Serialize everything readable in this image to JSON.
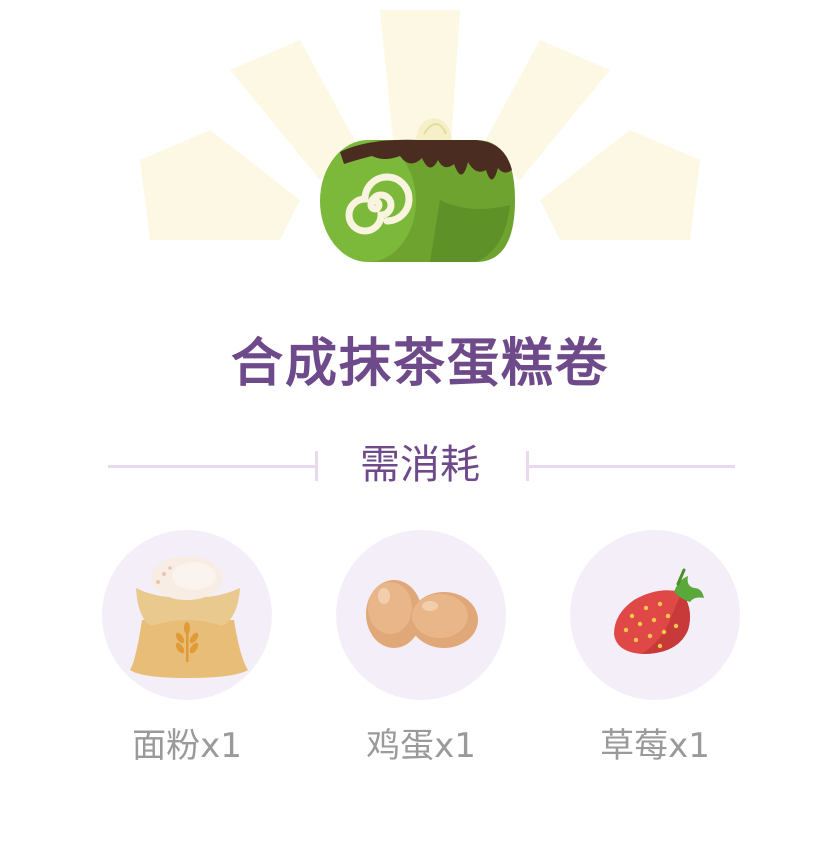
{
  "recipe": {
    "title": "合成抹茶蛋糕卷",
    "image_icon": "matcha-cake-roll-icon"
  },
  "consume": {
    "label": "需消耗"
  },
  "ingredients": [
    {
      "icon": "flour-sack-icon",
      "label": "面粉x1"
    },
    {
      "icon": "eggs-icon",
      "label": "鸡蛋x1"
    },
    {
      "icon": "strawberry-icon",
      "label": "草莓x1"
    }
  ],
  "colors": {
    "title": "#6e4a8a",
    "label": "#9a9a9a",
    "circle_bg": "#f4eef9",
    "divider": "#e8d9ee",
    "glow": "#fdf8e4"
  }
}
